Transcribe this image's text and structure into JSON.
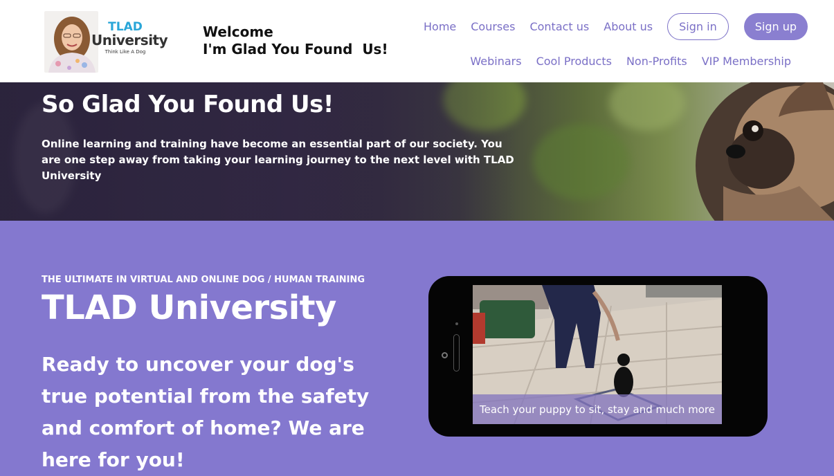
{
  "header": {
    "logo": {
      "line1": "TLAD",
      "line2": "University",
      "tagline": "Think Like A Dog"
    },
    "welcome_line1": "Welcome",
    "welcome_line2": "I'm Glad You Found  Us!",
    "nav_primary": [
      "Home",
      "Courses",
      "Contact us",
      "About us"
    ],
    "signin_label": "Sign in",
    "signup_label": "Sign up",
    "nav_secondary": [
      "Webinars",
      "Cool Products",
      "Non-Profits",
      "VIP Membership"
    ]
  },
  "hero": {
    "title": "So Glad You Found Us!",
    "text": "Online learning and training have become an essential part of our society. You are one step away from taking your learning journey to the next level with TLAD University"
  },
  "main": {
    "eyebrow": "THE ULTIMATE IN VIRTUAL AND ONLINE DOG / HUMAN TRAINING",
    "title": "TLAD University",
    "lead": "Ready to uncover your dog's true potential from the safety and comfort of home?  We are here for you!",
    "video_caption": "Teach your puppy to sit, stay and much more"
  },
  "colors": {
    "accent": "#8478cf",
    "nav_text": "#7a6fc6",
    "logo_blue": "#2aa6d8"
  }
}
